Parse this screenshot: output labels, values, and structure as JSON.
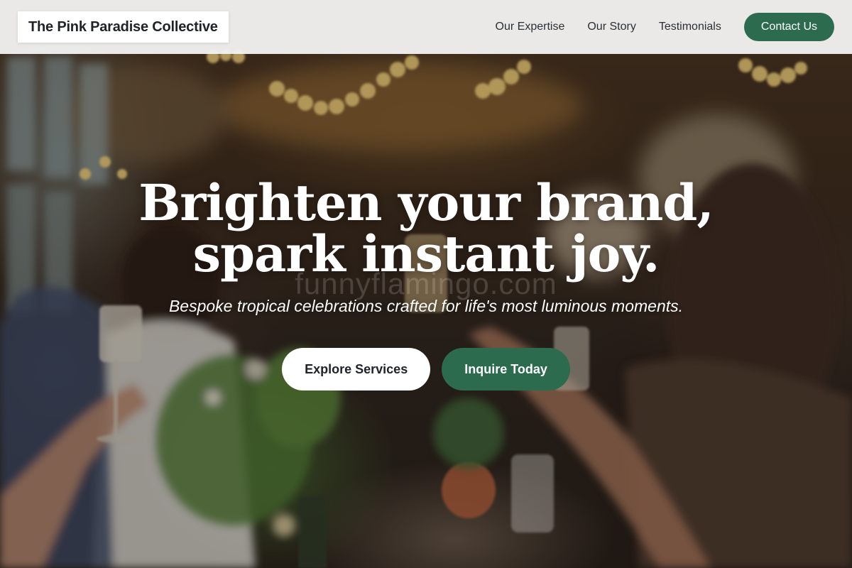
{
  "header": {
    "brand": "The Pink Paradise Collective",
    "nav": {
      "expertise": "Our Expertise",
      "story": "Our Story",
      "testimonials": "Testimonials"
    },
    "contact_label": "Contact Us"
  },
  "hero": {
    "title_line1": "Brighten your brand,",
    "title_line2": "spark instant joy.",
    "subtitle": "Bespoke tropical celebrations crafted for life's most luminous moments.",
    "watermark": "funnyflamingo.com",
    "primary_action": "Explore Services",
    "secondary_action": "Inquire Today"
  },
  "colors": {
    "accent_green": "#2c6b4e",
    "header_bg": "#f5f5f4",
    "text_dark": "#1f2328",
    "text_light": "#ffffff"
  }
}
